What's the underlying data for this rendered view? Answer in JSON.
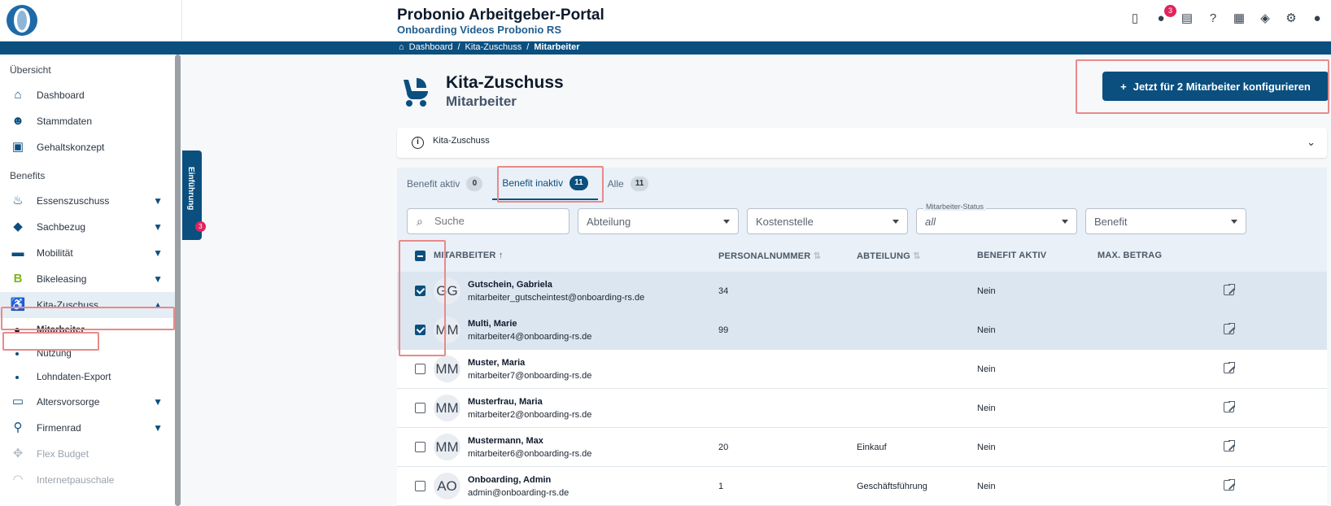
{
  "header": {
    "title": "Probonio Arbeitgeber-Portal",
    "subtitle": "Onboarding Videos Probonio RS",
    "notification_count": "3"
  },
  "breadcrumb": [
    "Dashboard",
    "/",
    "Kita-Zuschuss",
    "/",
    "Mitarbeiter"
  ],
  "sidebar": {
    "section_overview": "Übersicht",
    "overview_items": [
      {
        "label": "Dashboard",
        "icon": "home-icon"
      },
      {
        "label": "Stammdaten",
        "icon": "people-icon"
      },
      {
        "label": "Gehaltskonzept",
        "icon": "calculator-icon"
      }
    ],
    "section_benefits": "Benefits",
    "benefit_items": [
      {
        "label": "Essenszuschuss",
        "icon": "food-icon"
      },
      {
        "label": "Sachbezug",
        "icon": "tag-icon"
      },
      {
        "label": "Mobilität",
        "icon": "bus-icon"
      },
      {
        "label": "Bikeleasing",
        "icon": "bikeleasing-icon"
      },
      {
        "label": "Kita-Zuschuss",
        "icon": "stroller-icon"
      }
    ],
    "kita_sub": [
      "Mitarbeiter",
      "Nutzung",
      "Lohndaten-Export"
    ],
    "more_items": [
      {
        "label": "Altersvorsorge",
        "icon": "sofa-icon"
      },
      {
        "label": "Firmenrad",
        "icon": "bicycle-icon"
      },
      {
        "label": "Flex Budget",
        "icon": "move-icon"
      },
      {
        "label": "Internetpauschale",
        "icon": "wifi-icon"
      }
    ]
  },
  "intro_tab": {
    "label": "Einführung",
    "count": "3"
  },
  "page": {
    "title": "Kita-Zuschuss",
    "subtitle": "Mitarbeiter",
    "configure_button": "Jetzt für 2 Mitarbeiter konfigurieren",
    "accordion_title": "Kita-Zuschuss"
  },
  "tabs": [
    {
      "label": "Benefit aktiv",
      "count": "0"
    },
    {
      "label": "Benefit inaktiv",
      "count": "11"
    },
    {
      "label": "Alle",
      "count": "11"
    }
  ],
  "filters": {
    "search_placeholder": "Suche",
    "department": "Abteilung",
    "cost_center": "Kostenstelle",
    "status_legend": "Mitarbeiter-Status",
    "status_value": "all",
    "benefit": "Benefit"
  },
  "table": {
    "headers": [
      "MITARBEITER",
      "PERSONALNUMMER",
      "ABTEILUNG",
      "BENEFIT AKTIV",
      "MAX. BETRAG"
    ],
    "rows": [
      {
        "initials": "GG",
        "name": "Gutschein, Gabriela",
        "email": "mitarbeiter_gutscheintest@onboarding-rs.de",
        "pn": "34",
        "dept": "",
        "active": "Nein",
        "selected": true
      },
      {
        "initials": "MM",
        "name": "Multi, Marie",
        "email": "mitarbeiter4@onboarding-rs.de",
        "pn": "99",
        "dept": "",
        "active": "Nein",
        "selected": true
      },
      {
        "initials": "MM",
        "name": "Muster, Maria",
        "email": "mitarbeiter7@onboarding-rs.de",
        "pn": "",
        "dept": "",
        "active": "Nein",
        "selected": false
      },
      {
        "initials": "MM",
        "name": "Musterfrau, Maria",
        "email": "mitarbeiter2@onboarding-rs.de",
        "pn": "",
        "dept": "",
        "active": "Nein",
        "selected": false
      },
      {
        "initials": "MM",
        "name": "Mustermann, Max",
        "email": "mitarbeiter6@onboarding-rs.de",
        "pn": "20",
        "dept": "Einkauf",
        "active": "Nein",
        "selected": false
      },
      {
        "initials": "AO",
        "name": "Onboarding, Admin",
        "email": "admin@onboarding-rs.de",
        "pn": "1",
        "dept": "Geschäftsführung",
        "active": "Nein",
        "selected": false
      }
    ]
  },
  "colors": {
    "primary": "#0b4f7f",
    "highlight": "#e88a8a",
    "badge": "#e0245e"
  }
}
